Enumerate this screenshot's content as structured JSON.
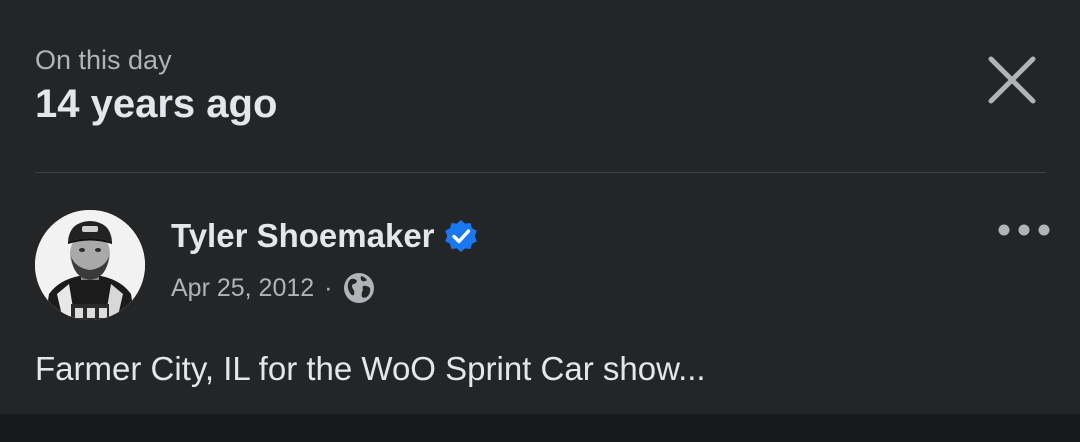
{
  "memory": {
    "subtitle": "On this day",
    "title": "14 years ago"
  },
  "icons": {
    "close": "close-icon",
    "verified": "verified-badge-icon",
    "privacy": "globe-icon",
    "more": "more-options-icon"
  },
  "post": {
    "author": "Tyler Shoemaker",
    "date": "Apr 25, 2012",
    "separator": "·",
    "text": "Farmer City, IL for the WoO Sprint Car show..."
  },
  "colors": {
    "background": "#242526",
    "primary_text": "#e4e6eb",
    "secondary_text": "#b0b3b8",
    "verified_blue": "#1877f2",
    "divider": "#3e4042"
  }
}
